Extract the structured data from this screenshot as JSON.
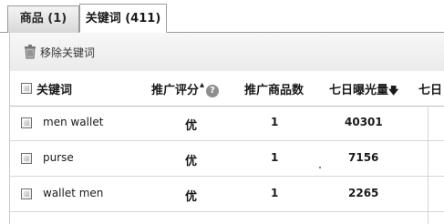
{
  "tabs": [
    {
      "label": "商品 (1)"
    },
    {
      "label": "关键词 (411)"
    }
  ],
  "toolbar": {
    "remove_label": "移除关键词"
  },
  "table": {
    "headers": {
      "keyword": "关键词",
      "score": "推广评分",
      "product_count": "推广商品数",
      "exposure_7d": "七日曝光量",
      "next_col_partial": "七日"
    },
    "rows": [
      {
        "keyword": "men wallet",
        "score": "优",
        "product_count": "1",
        "exposure_7d": "40301"
      },
      {
        "keyword": "purse",
        "score": "优",
        "product_count": "1",
        "exposure_7d": "7156"
      },
      {
        "keyword": "wallet men",
        "score": "优",
        "product_count": "1",
        "exposure_7d": "2265"
      }
    ]
  },
  "icons": {
    "trash": "trash-icon",
    "help": "help-icon",
    "sort": "sort-desc-icon"
  }
}
